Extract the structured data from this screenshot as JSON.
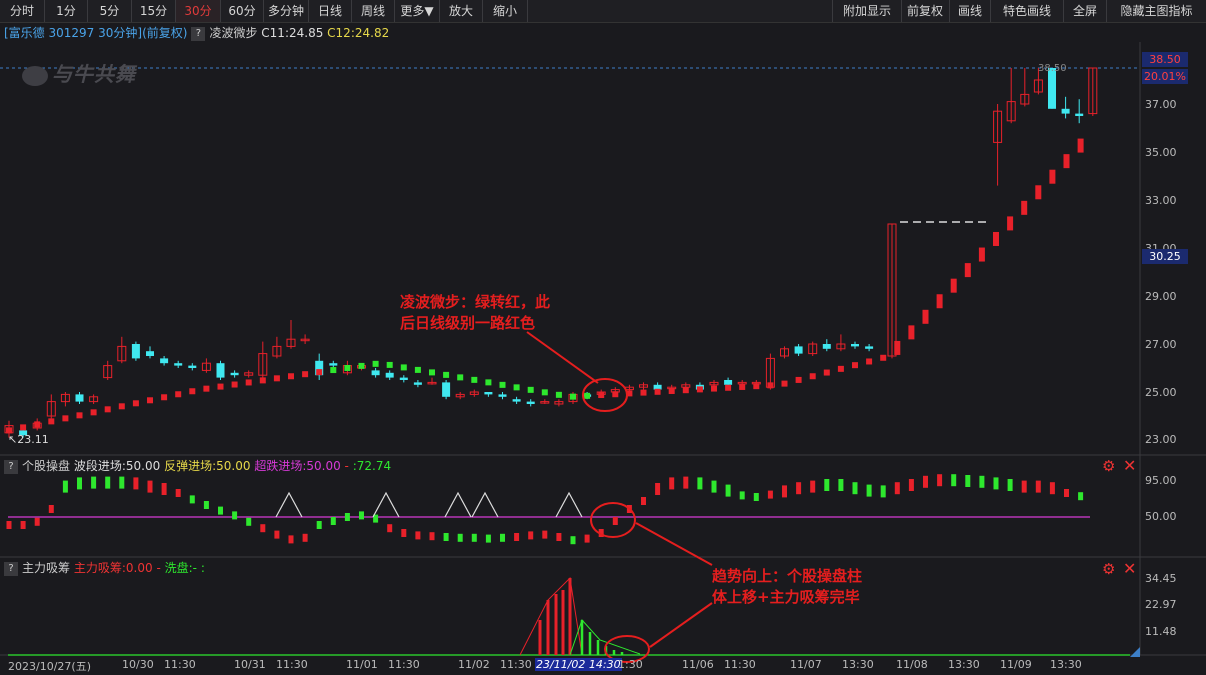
{
  "toolbar": {
    "left": [
      "分时",
      "1分",
      "5分",
      "15分",
      "30分",
      "60分",
      "多分钟",
      "日线",
      "周线",
      "更多▼",
      "放大",
      "缩小"
    ],
    "right": [
      "附加显示",
      "前复权",
      "画线",
      "特色画线",
      "全屏",
      "隐藏主图指标"
    ]
  },
  "info": {
    "stock": "[富乐德 301297 30分钟]",
    "adjust": "(前复权)",
    "help": "?",
    "indicator": "凌波微步",
    "c1": "C11:24.85",
    "c2": "C12:24.82"
  },
  "main_chart": {
    "watermark": "与牛共舞",
    "y_labels": [
      "37.00",
      "35.00",
      "33.00",
      "31.00",
      "29.00",
      "27.00",
      "25.00",
      "23.00"
    ],
    "price_high_box": "38.50",
    "pct_box": "20.01%",
    "dashed_label": "38.50",
    "price_box_2": "30.25",
    "low_label": "23.11"
  },
  "panel2": {
    "help": "?",
    "name": "个股操盘",
    "l1": "波段进场:50.00",
    "l2": "反弹进场:50.00",
    "l3": "超跌进场:50.00",
    "l4": "-",
    "l5": ":72.74",
    "y_labels": [
      "95.00",
      "50.00"
    ]
  },
  "panel3": {
    "help": "?",
    "name": "主力吸筹",
    "l1": "主力吸筹:0.00",
    "l2": "-",
    "l3": "洗盘:-",
    "l4": ":",
    "y_labels": [
      "34.45",
      "22.97",
      "11.48"
    ]
  },
  "x_axis": [
    "2023/10/27(五)",
    "10/30",
    "11:30",
    "10/31",
    "11:30",
    "11/01",
    "11:30",
    "11/02",
    "11:30",
    "23/11/02 14:30",
    "1:30",
    "11/06",
    "11:30",
    "11/07",
    "13:30",
    "11/08",
    "13:30",
    "11/09",
    "13:30"
  ],
  "annotations": {
    "a1_line1": "凌波微步：绿转红，此",
    "a1_line2": "后日线级别一路红色",
    "a2_line1": "趋势向上：个股操盘柱",
    "a2_line2": "体上移+主力吸筹完毕"
  },
  "colors": {
    "up": "#e8212a",
    "down": "#40e8f0",
    "green": "#2ee82e",
    "magenta": "#d63ad6",
    "accent": "#e33b3b"
  }
}
